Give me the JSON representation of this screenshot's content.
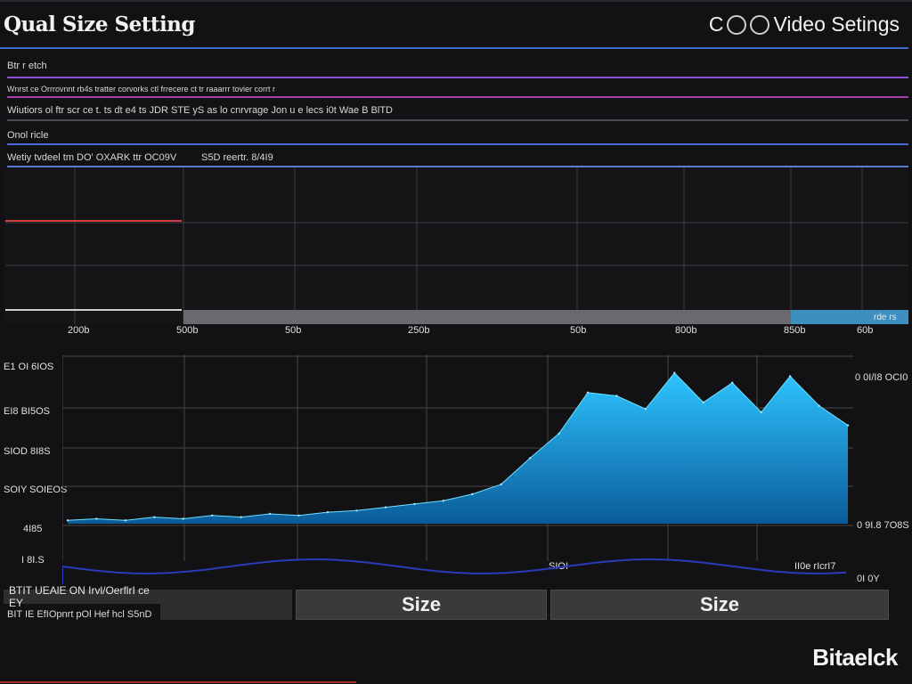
{
  "header": {
    "title": "Qual Size Setting",
    "right_title": "Video Setings",
    "right_prefix": "C"
  },
  "rows": [
    {
      "text": "Btr r etch",
      "color": "#8a4fd4"
    },
    {
      "text": "Wnrst ce  Orrrovnnt  rb4s tratter corvorks ctl frrecere ct  tr  raaarrr tovier corrt r",
      "color": "#a040a8"
    },
    {
      "text": "Wiutiors  ol  ftr  scr  ce  t.  ts  dt  e4 ts  JDR  STE  yS  as  lo  cnrvrage  Jon   u  e  lecs  i0t  Wae  B  BlTD",
      "color": "#4a4a52"
    },
    {
      "text": "Onol  ricle",
      "color": "#4a6ad8"
    },
    {
      "text": "Wetiy tvdeel tm DO' OXARK ttr OC09V",
      "text2": "S5D reertr. 8/4I9",
      "color": "#5a7ad0"
    }
  ],
  "top_chart": {
    "x_ticks": [
      "200b",
      "500b",
      "50b",
      "250b",
      "50b",
      "800b",
      "850b",
      "60b"
    ],
    "band_label": "rde rs",
    "red_line_color": "#d04040",
    "band_color": "#6a6a6e",
    "band_accent": "#3e8fbf"
  },
  "chart_data": {
    "type": "area",
    "series": [
      {
        "values": [
          2,
          3,
          2,
          4,
          3,
          5,
          4,
          6,
          5,
          7,
          8,
          10,
          12,
          14,
          18,
          24,
          40,
          55,
          80,
          78,
          70,
          92,
          74,
          86,
          68,
          90,
          72,
          60
        ]
      }
    ],
    "y_tick_labels": [
      "E1 OI 6IOS",
      "EI8 BI5OS",
      "SIOD 8I8S",
      "SOIY SOIEOS",
      "4I85",
      "I 8I.S"
    ],
    "right_labels": [
      "0 0I/I8 OCI0",
      "0 9I.8 7O8S"
    ],
    "bottom_labels": [
      "SIOI",
      "II0e rIcrI7"
    ],
    "fill_color": "#1aa8e6",
    "line_color": "#2b3bb8"
  },
  "footer": {
    "left_line1": "BTIT  UEAlE  ON  Irvl/OerflrI  ce EY",
    "left_line2": "BIT IE  EfIOpnrt  pOl  Hef  hcl  S5nD",
    "button1_label": "Size",
    "button2_label": "Size",
    "brand": "Bitaelck",
    "right_small": "0I 0Y"
  }
}
